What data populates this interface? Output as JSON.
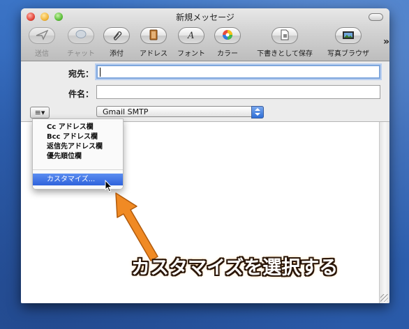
{
  "window": {
    "title": "新規メッセージ"
  },
  "toolbar": {
    "buttons": [
      {
        "label": "送信",
        "icon": "send-icon",
        "enabled": false
      },
      {
        "label": "チャット",
        "icon": "chat-icon",
        "enabled": false
      },
      {
        "label": "添付",
        "icon": "paperclip-icon",
        "enabled": true
      },
      {
        "label": "アドレス",
        "icon": "address-book-icon",
        "enabled": true
      },
      {
        "label": "フォント",
        "icon": "font-icon",
        "enabled": true
      },
      {
        "label": "カラー",
        "icon": "color-wheel-icon",
        "enabled": true
      },
      {
        "label": "下書きとして保存",
        "icon": "save-draft-icon",
        "enabled": true
      },
      {
        "label": "写真ブラウザ",
        "icon": "photo-browser-icon",
        "enabled": true
      }
    ],
    "overflow": "»"
  },
  "compose": {
    "to_label": "宛先：",
    "to_value": "",
    "subject_label": "件名：",
    "subject_value": "",
    "account_value": "Gmail SMTP",
    "list_button": "≡▾"
  },
  "header_menu": {
    "items": [
      "Cc アドレス欄",
      "Bcc アドレス欄",
      "返信先アドレス欄",
      "優先順位欄"
    ],
    "customize": "カスタマイズ..."
  },
  "annotation": {
    "caption": "カスタマイズを選択する",
    "color": "#f08a24"
  }
}
